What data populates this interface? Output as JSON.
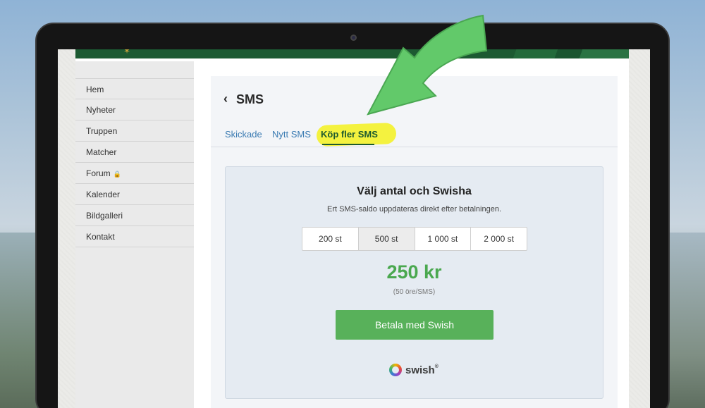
{
  "sidebar": {
    "items": [
      {
        "label": "Hem"
      },
      {
        "label": "Nyheter"
      },
      {
        "label": "Truppen"
      },
      {
        "label": "Matcher"
      },
      {
        "label": "Forum",
        "icon": "lock-icon"
      },
      {
        "label": "Kalender"
      },
      {
        "label": "Bildgalleri"
      },
      {
        "label": "Kontakt"
      }
    ]
  },
  "header": {
    "back_icon": "chevron-left-icon",
    "title": "SMS"
  },
  "tabs": [
    {
      "label": "Skickade"
    },
    {
      "label": "Nytt SMS"
    },
    {
      "label": "Köp fler SMS",
      "active": true
    }
  ],
  "purchase": {
    "title": "Välj antal och Swisha",
    "subtitle": "Ert SMS-saldo uppdateras direkt efter betalningen.",
    "options": [
      {
        "label": "200 st"
      },
      {
        "label": "500 st",
        "selected": true
      },
      {
        "label": "1 000 st"
      },
      {
        "label": "2 000 st"
      }
    ],
    "price": "250 kr",
    "price_note": "(50 öre/SMS)",
    "pay_button": "Betala med Swish",
    "brand_text": "swish",
    "brand_sup": "®"
  },
  "colors": {
    "accent_green": "#4aa84f",
    "button_green": "#58b15a",
    "link_blue": "#3b7bb2",
    "header_green": "#1c5a32",
    "highlight": "#f4f12f",
    "arrow_green": "#62c96a"
  },
  "annotations": {
    "arrow_icon": "curved-arrow-icon"
  }
}
